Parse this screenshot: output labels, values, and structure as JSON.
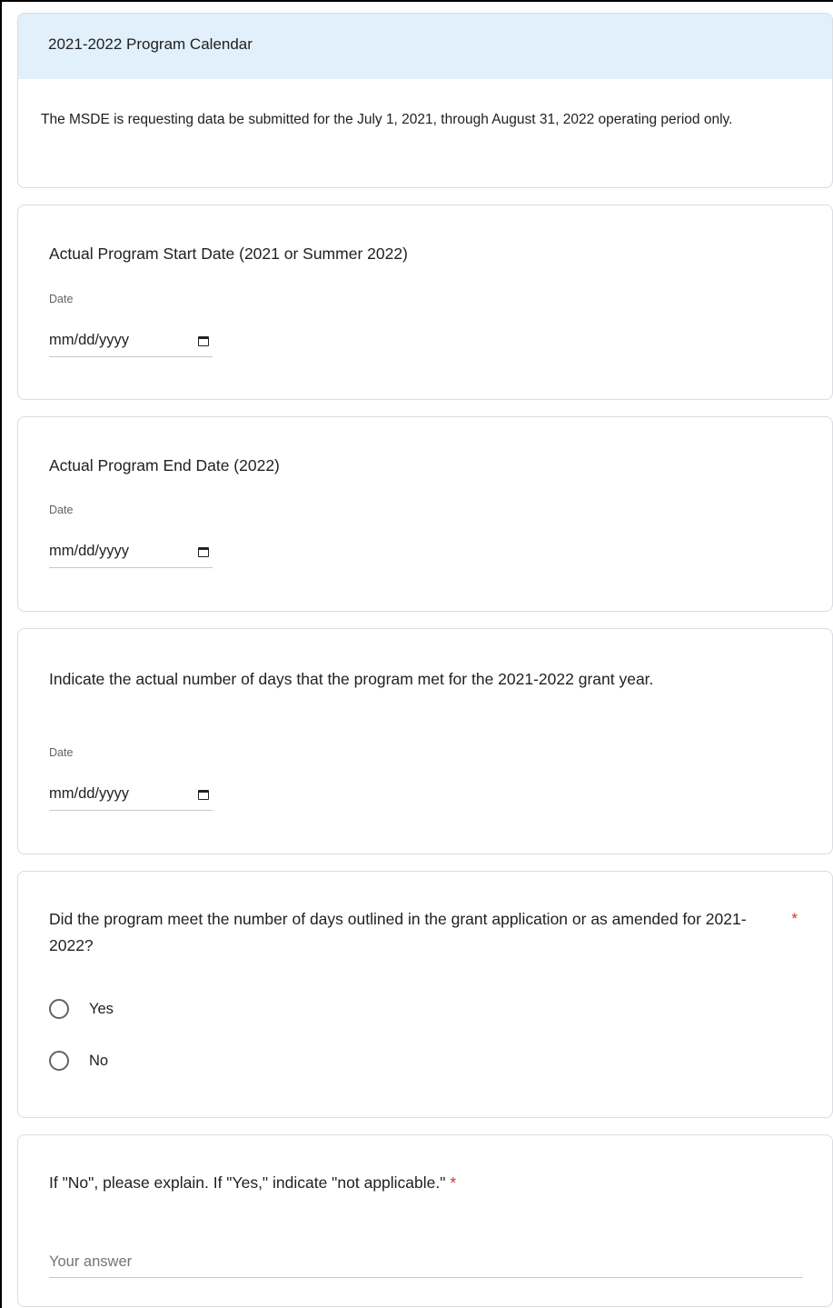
{
  "section": {
    "title": "2021-2022 Program Calendar",
    "description": "The MSDE is requesting data be submitted for the July 1, 2021, through August 31, 2022 operating period only."
  },
  "questions": [
    {
      "title": "Actual Program Start Date (2021 or Summer 2022)",
      "type_label": "Date",
      "placeholder": "mm/dd/yyyy"
    },
    {
      "title": "Actual Program End Date (2022)",
      "type_label": "Date",
      "placeholder": "mm/dd/yyyy"
    },
    {
      "title": "Indicate the actual number of days that the program met for the 2021-2022 grant year.",
      "type_label": "Date",
      "placeholder": "mm/dd/yyyy"
    },
    {
      "title": "Did the program meet the number of days outlined in the grant application or as amended for 2021-2022?",
      "required_mark": "*",
      "options": [
        "Yes",
        "No"
      ]
    },
    {
      "title": "If \"No\", please explain. If \"Yes,\" indicate \"not applicable.\"",
      "required_mark": "*",
      "placeholder": "Your answer"
    }
  ],
  "colors": {
    "header_bg": "#e1f0fa",
    "required": "#d93025",
    "border": "#dadce0"
  }
}
